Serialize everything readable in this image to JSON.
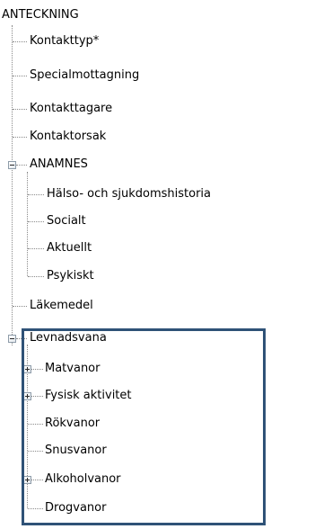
{
  "tree": {
    "root": "ANTECKNING",
    "items": {
      "kontakttyp": "Kontakttyp*",
      "specialmottagning": "Specialmottagning",
      "kontakttagare": "Kontakttagare",
      "kontaktorsak": "Kontaktorsak",
      "anamnes": "ANAMNES",
      "halso_sjukdomshistoria": "Hälso- och sjukdomshistoria",
      "socialt": "Socialt",
      "aktuellt": "Aktuellt",
      "psykiskt": "Psykiskt",
      "lakemedel": "Läkemedel",
      "levnadsvana": "Levnadsvana",
      "matvanor": "Matvanor",
      "fysisk_aktivitet": "Fysisk aktivitet",
      "rokvanor": "Rökvanor",
      "snusvanor": "Snusvanor",
      "alkoholvanor": "Alkoholvanor",
      "drogvanor": "Drogvanor"
    },
    "toggle_icons": {
      "collapse": "minus-box-icon",
      "expand": "plus-box-icon"
    },
    "highlight_color": "#2f5277"
  }
}
